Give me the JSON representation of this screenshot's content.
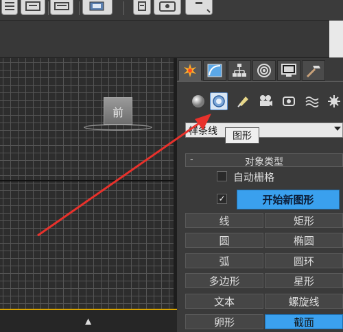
{
  "toolbar": {
    "icons": [
      "select-list-icon",
      "window-crossing-icon",
      "align-icon",
      "layer-manager-icon",
      "material-editor-icon",
      "render-setup-icon",
      "render-icon"
    ]
  },
  "viewport": {
    "view_cube_label": "前",
    "bottom_icon": "lock-icon"
  },
  "command_panel": {
    "tabs": [
      "create-icon",
      "modify-icon",
      "hierarchy-icon",
      "motion-icon",
      "display-icon",
      "utilities-icon"
    ],
    "active_tab": "create-icon",
    "sub_icons": [
      "geometry-icon",
      "shapes-icon",
      "lights-icon",
      "cameras-icon",
      "helpers-icon",
      "space-warps-icon",
      "systems-icon"
    ],
    "active_sub_icon": "shapes-icon",
    "dropdown_value": "样条线",
    "tooltip": "图形",
    "rollout_toggle": "-",
    "rollout_title": "对象类型",
    "auto_grid_label": "自动栅格",
    "auto_grid_checked": false,
    "start_new_shape_label": "开始新图形",
    "start_new_shape_checked": true,
    "check_mark": "✓",
    "buttons": [
      {
        "label": "线"
      },
      {
        "label": "矩形"
      },
      {
        "label": "圆"
      },
      {
        "label": "椭圆"
      },
      {
        "label": "弧"
      },
      {
        "label": "圆环"
      },
      {
        "label": "多边形"
      },
      {
        "label": "星形"
      },
      {
        "label": "文本"
      },
      {
        "label": "螺旋线"
      },
      {
        "label": "卵形"
      },
      {
        "label": "截面"
      }
    ],
    "selected_button": "截面"
  },
  "colors": {
    "accent_blue": "#3aa0ee",
    "annotation_arrow": "#e8312b",
    "viewport_border": "#d9a400"
  }
}
